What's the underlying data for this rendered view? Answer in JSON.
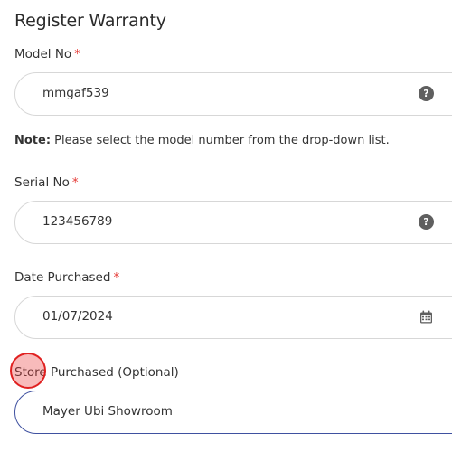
{
  "form": {
    "title": "Register Warranty",
    "required_mark": "*",
    "model": {
      "label": "Model No",
      "value": "mmgaf539",
      "help_icon": "?"
    },
    "note": {
      "prefix": "Note:",
      "text": " Please select the model number from the drop-down list."
    },
    "serial": {
      "label": "Serial No",
      "value": "123456789",
      "help_icon": "?"
    },
    "date": {
      "label": "Date Purchased",
      "value": "01/07/2024",
      "icon": "calendar-icon"
    },
    "store": {
      "label": "Store Purchased (Optional)",
      "value": "Mayer Ubi Showroom"
    }
  },
  "colors": {
    "required": "#e53935",
    "active_border": "#3f51a0",
    "border": "#d7d7d7",
    "icon": "#5f5f5f",
    "click_marker": "#e02020"
  }
}
